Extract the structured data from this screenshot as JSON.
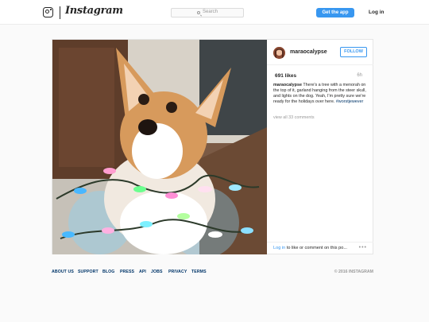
{
  "nav": {
    "logo_text": "Instagram",
    "search_placeholder": "Search",
    "get_app_label": "Get the app",
    "login_label": "Log in"
  },
  "post": {
    "username": "maraocalypse",
    "follow_label": "FOLLOW",
    "likes": "691 likes",
    "time": "6h",
    "caption_username": "maraocalypse",
    "caption_text": "There's a tree with a menorah on the top of it, garland hanging from the steer skull, and lights on the dog. Yeah, I'm pretty sure we're ready for the holidays over here.",
    "hashtag": "#worstjewever",
    "view_comments": "view all 33 comments",
    "comment_login_link": "Log in",
    "comment_prompt": "to like or comment on this po...",
    "more_glyph": "•••"
  },
  "footer": {
    "links": [
      "ABOUT US",
      "SUPPORT",
      "BLOG",
      "PRESS",
      "API",
      "JOBS",
      "PRIVACY",
      "TERMS"
    ],
    "copyright": "© 2016 INSTAGRAM"
  },
  "colors": {
    "accent": "#3897f0",
    "link_dark": "#003569",
    "muted": "#999999",
    "text": "#262626"
  },
  "icons": {
    "camera": "instagram-camera-icon",
    "search": "search-icon",
    "more": "more-options-icon"
  }
}
